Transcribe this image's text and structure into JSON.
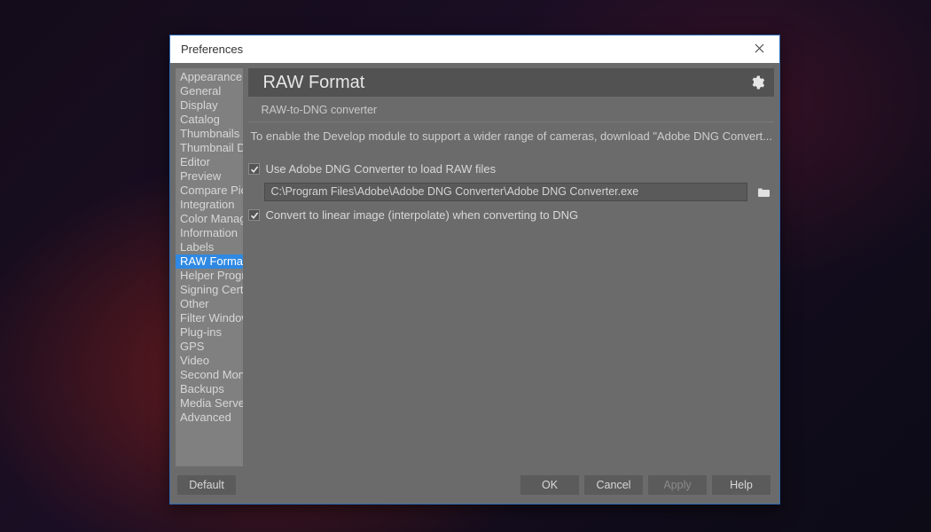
{
  "window": {
    "title": "Preferences"
  },
  "sidebar": {
    "items": [
      {
        "label": "Appearance"
      },
      {
        "label": "General"
      },
      {
        "label": "Display"
      },
      {
        "label": "Catalog"
      },
      {
        "label": "Thumbnails"
      },
      {
        "label": "Thumbnail Descriptions"
      },
      {
        "label": "Editor"
      },
      {
        "label": "Preview"
      },
      {
        "label": "Compare Pictures"
      },
      {
        "label": "Integration"
      },
      {
        "label": "Color Management"
      },
      {
        "label": "Information"
      },
      {
        "label": "Labels"
      },
      {
        "label": "RAW Format",
        "selected": true
      },
      {
        "label": "Helper Programs"
      },
      {
        "label": "Signing Certificates"
      },
      {
        "label": "Other"
      },
      {
        "label": "Filter Windows"
      },
      {
        "label": "Plug-ins"
      },
      {
        "label": "GPS"
      },
      {
        "label": "Video"
      },
      {
        "label": "Second Monitor"
      },
      {
        "label": "Backups"
      },
      {
        "label": "Media Server"
      },
      {
        "label": "Advanced"
      }
    ]
  },
  "content": {
    "title": "RAW Format",
    "section": "RAW-to-DNG converter",
    "description": "To enable the Develop module to support a wider range of cameras, download \"Adobe DNG Convert...",
    "checkbox_use_converter": "Use Adobe DNG Converter to load RAW files",
    "converter_path": "C:\\Program Files\\Adobe\\Adobe DNG Converter\\Adobe DNG Converter.exe",
    "checkbox_linear": "Convert to linear image (interpolate) when converting to DNG"
  },
  "footer": {
    "default": "Default",
    "ok": "OK",
    "cancel": "Cancel",
    "apply": "Apply",
    "help": "Help"
  },
  "colors": {
    "selection": "#2f89e3"
  }
}
